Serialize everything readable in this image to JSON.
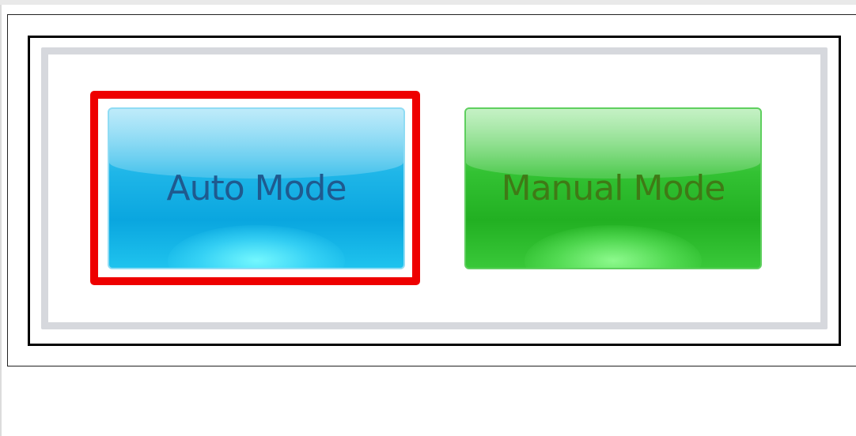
{
  "mode_panel": {
    "auto_button": {
      "label": "Auto Mode",
      "selected": true,
      "color": "#0aa6df",
      "text_color": "#1f5a8f"
    },
    "manual_button": {
      "label": "Manual Mode",
      "selected": false,
      "color": "#22b022",
      "text_color": "#3f7a16"
    },
    "selection_highlight_color": "#ee0000"
  }
}
